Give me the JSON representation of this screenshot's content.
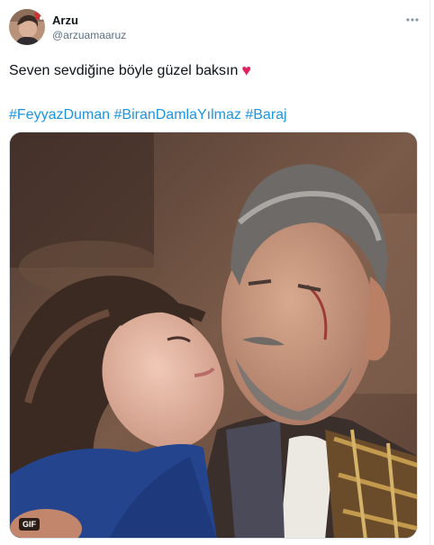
{
  "tweet": {
    "author": {
      "display_name": "Arzu",
      "handle": "@arzuamaaruz"
    },
    "more_icon": "more-horizontal-icon",
    "text": "Seven sevdiğine böyle güzel baksın",
    "emoji": "♥",
    "hashtags": [
      "#FeyyazDuman",
      "#BiranDamlaYılmaz",
      "#Baraj"
    ],
    "media": {
      "badge": "GIF"
    }
  },
  "colors": {
    "hashtag": "#1b95e0",
    "heart": "#e0245e",
    "handle": "#5b7083"
  }
}
